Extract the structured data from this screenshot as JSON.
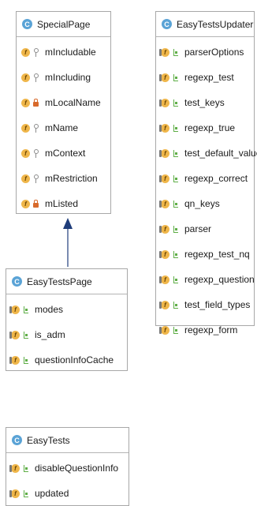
{
  "classes": [
    {
      "name": "SpecialPage",
      "icon": "class-icon",
      "fields": [
        {
          "name": "mIncludable",
          "visibility": "key-icon"
        },
        {
          "name": "mIncluding",
          "visibility": "key-icon"
        },
        {
          "name": "mLocalName",
          "visibility": "lock-icon"
        },
        {
          "name": "mName",
          "visibility": "key-icon"
        },
        {
          "name": "mContext",
          "visibility": "key-icon"
        },
        {
          "name": "mRestriction",
          "visibility": "key-icon"
        },
        {
          "name": "mListed",
          "visibility": "lock-icon"
        }
      ]
    },
    {
      "name": "EasyTestsUpdater",
      "icon": "class-icon",
      "fields": [
        {
          "name": "parserOptions",
          "visibility": "package-icon"
        },
        {
          "name": "regexp_test",
          "visibility": "package-icon"
        },
        {
          "name": "test_keys",
          "visibility": "package-icon"
        },
        {
          "name": "regexp_true",
          "visibility": "package-icon"
        },
        {
          "name": "test_default_values",
          "visibility": "package-icon"
        },
        {
          "name": "regexp_correct",
          "visibility": "package-icon"
        },
        {
          "name": "qn_keys",
          "visibility": "package-icon"
        },
        {
          "name": "parser",
          "visibility": "package-icon"
        },
        {
          "name": "regexp_test_nq",
          "visibility": "package-icon"
        },
        {
          "name": "regexp_question",
          "visibility": "package-icon"
        },
        {
          "name": "test_field_types",
          "visibility": "package-icon"
        },
        {
          "name": "regexp_form",
          "visibility": "package-icon"
        }
      ]
    },
    {
      "name": "EasyTestsPage",
      "icon": "class-icon",
      "fields": [
        {
          "name": "modes",
          "visibility": "package-icon"
        },
        {
          "name": "is_adm",
          "visibility": "package-icon"
        },
        {
          "name": "questionInfoCache",
          "visibility": "package-icon"
        }
      ]
    },
    {
      "name": "EasyTests",
      "icon": "class-icon",
      "fields": [
        {
          "name": "disableQuestionInfo",
          "visibility": "package-icon"
        },
        {
          "name": "updated",
          "visibility": "package-icon"
        }
      ]
    }
  ],
  "relations": [
    {
      "from": "EasyTestsPage",
      "to": "SpecialPage",
      "type": "inheritance"
    }
  ],
  "colors": {
    "class_icon": "#5aa3d6",
    "field_icon": "#efb64a",
    "arrow": "#1f3d7a",
    "border": "#a8a8a8"
  }
}
